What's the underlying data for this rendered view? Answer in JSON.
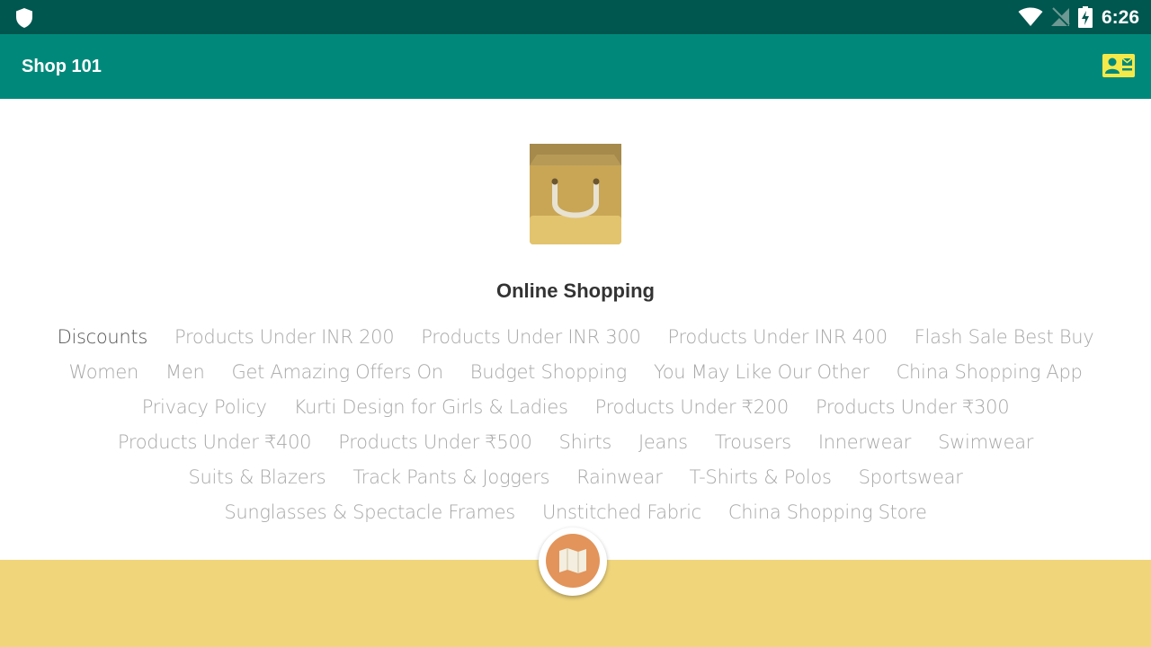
{
  "status_bar": {
    "time": "6:26",
    "icons": [
      "shield-icon",
      "wifi-icon",
      "no-signal-icon",
      "battery-charging-icon"
    ]
  },
  "app_bar": {
    "title": "Shop 101",
    "action_icon": "contact-card-icon"
  },
  "main": {
    "logo_icon": "shopping-bag-icon",
    "heading": "Online Shopping",
    "tags": [
      "Discounts",
      "Products Under INR 200",
      "Products Under INR 300",
      "Products Under INR 400",
      "Flash Sale Best Buy",
      "Women",
      "Men",
      "Get Amazing Offers On",
      "Budget Shopping",
      "You May Like Our Other",
      "China Shopping App",
      "Privacy Policy",
      "Kurti Design for Girls & Ladies",
      "Products Under ₹200",
      "Products Under ₹300",
      "Products Under ₹400",
      "Products Under ₹500",
      "Shirts",
      "Jeans",
      "Trousers",
      "Innerwear",
      "Swimwear",
      "Suits & Blazers",
      "Track Pants & Joggers",
      "Rainwear",
      "T-Shirts & Polos",
      "Sportswear",
      "Sunglasses & Spectacle Frames",
      "Unstitched Fabric",
      "China Shopping Store"
    ],
    "selected_tag": "Discounts"
  },
  "footer": {
    "fab_icon": "map-icon"
  },
  "colors": {
    "status_bar": "#00574f",
    "app_bar": "#00897b",
    "footer": "#f0d57b",
    "fab": "#e2945a",
    "tag_text": "#a8a8a8",
    "tag_selected": "#555555"
  }
}
